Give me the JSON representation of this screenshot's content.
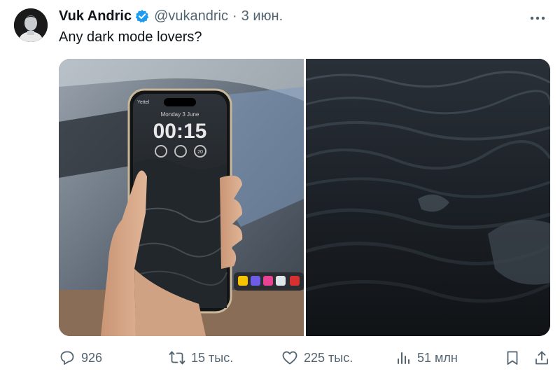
{
  "author": {
    "name": "Vuk Andric",
    "handle": "@vukandric",
    "separator": "·",
    "date": "3 июн."
  },
  "tweet": {
    "text": "Any dark mode lovers?"
  },
  "media": {
    "left_image": "phone-dark-lockscreen-photo",
    "right_image": "dark-ocean-waves-wallpaper",
    "phone": {
      "carrier": "Yettel",
      "date_line": "Monday 3 June",
      "time": "00:15",
      "widget_value": "20"
    }
  },
  "actions": {
    "replies": "926",
    "reposts": "15 тыс.",
    "likes": "225 тыс.",
    "views": "51 млн"
  },
  "colors": {
    "text": "#0f1419",
    "secondary": "#536471",
    "verified": "#1d9bf0"
  }
}
